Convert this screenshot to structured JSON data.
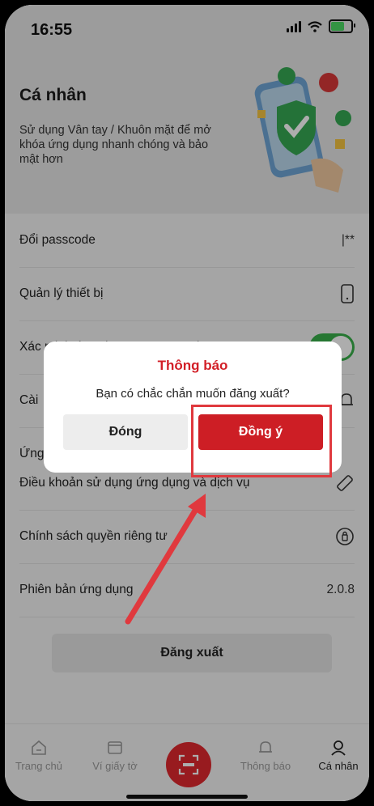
{
  "status_bar": {
    "time": "16:55"
  },
  "header": {
    "title": "Cá nhân",
    "description": "Sử dụng Vân tay / Khuôn mặt để mở khóa ứng dụng nhanh chóng và bảo mật hơn"
  },
  "settings": {
    "items": [
      {
        "label": "Đổi passcode",
        "right": "|**"
      },
      {
        "label": "Quản lý thiết bị",
        "icon": "phone-icon"
      },
      {
        "label": "Xác minh ứng dụng qua QR code",
        "toggle_on": true
      },
      {
        "label": "Cài",
        "icon": "bell-icon"
      },
      {
        "label": "Ứng"
      },
      {
        "label": "Điều khoản sử dụng ứng dụng và dịch vụ",
        "icon": "ruler-icon"
      },
      {
        "label": "Chính sách quyền riêng tư",
        "icon": "privacy-icon"
      },
      {
        "label": "Phiên bản ứng dụng",
        "right": "2.0.8"
      }
    ]
  },
  "logout_label": "Đăng xuất",
  "tabbar": {
    "items": [
      {
        "label": "Trang chủ",
        "icon": "home-icon"
      },
      {
        "label": "Ví giấy tờ",
        "icon": "wallet-icon"
      },
      {
        "label": "",
        "icon": "scan-icon"
      },
      {
        "label": "Thông báo",
        "icon": "bell-icon"
      },
      {
        "label": "Cá nhân",
        "icon": "person-icon",
        "active": true
      }
    ]
  },
  "dialog": {
    "title": "Thông báo",
    "message": "Bạn có chắc chắn muốn đăng xuất?",
    "close_label": "Đóng",
    "confirm_label": "Đồng ý"
  },
  "colors": {
    "brand_red": "#cd1e25",
    "toggle_green": "#38b04a",
    "annotation_red": "#e0393e"
  }
}
